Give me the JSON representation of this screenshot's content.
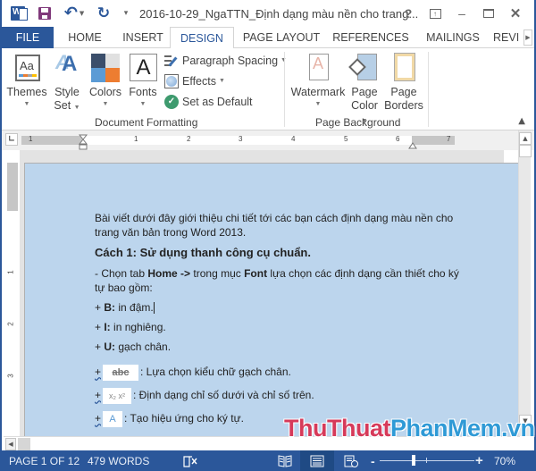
{
  "app": {
    "title": "2016-10-29_NgaTTN_Định dạng màu nền cho trang...",
    "icons": {
      "app_logo": "word-logo-icon",
      "save": "save-icon",
      "undo": "undo-icon",
      "redo": "redo-icon",
      "customize": "customize-qat-icon"
    },
    "window_controls": {
      "help": "?",
      "ribbon_display": "⊡",
      "minimize": "–",
      "maximize": "☐",
      "close": "✕"
    }
  },
  "tabs": [
    {
      "label": "FILE",
      "active": false
    },
    {
      "label": "HOME",
      "active": false
    },
    {
      "label": "INSERT",
      "active": false
    },
    {
      "label": "DESIGN",
      "active": true
    },
    {
      "label": "PAGE LAYOUT",
      "active": false
    },
    {
      "label": "REFERENCES",
      "active": false
    },
    {
      "label": "MAILINGS",
      "active": false
    },
    {
      "label": "REVI",
      "active": false
    }
  ],
  "ribbon": {
    "document_formatting": {
      "label": "Document Formatting",
      "themes": "Themes",
      "style_set_1": "Style",
      "style_set_2": "Set",
      "colors": "Colors",
      "fonts": "Fonts",
      "paragraph_spacing": "Paragraph Spacing",
      "effects": "Effects",
      "set_as_default": "Set as Default",
      "theme_colors": [
        "#3b4e6b",
        "#e0e0e0",
        "#5b9bd5",
        "#ed7d31"
      ]
    },
    "page_background": {
      "label": "Page Background",
      "watermark": "Watermark",
      "page_color_1": "Page",
      "page_color_2": "Color",
      "page_borders_1": "Page",
      "page_borders_2": "Borders"
    }
  },
  "ruler": {
    "marks": [
      "1",
      "1",
      "2",
      "3",
      "4",
      "5",
      "6",
      "7"
    ],
    "vertical_marks": [
      "1",
      "2",
      "3"
    ]
  },
  "document": {
    "page_color": "#bcd5ed",
    "intro": "Bài viết dưới đây giới thiệu chi tiết tới các bạn cách định dạng màu nền cho trang văn bản trong Word 2013.",
    "heading": "Cách 1: Sử dụng thanh công cụ chuẩn.",
    "step_prefix": "- Chọn tab ",
    "step_home": "Home ->",
    "step_mid": " trong mục ",
    "step_font": "Font",
    "step_suffix": " lựa chọn các định dạng cần thiết cho ký tự bao gồm:",
    "items": [
      {
        "prefix": "+ ",
        "key": "B:",
        "text": " in đậm."
      },
      {
        "prefix": "+ ",
        "key": "I:",
        "text": " in nghiêng."
      },
      {
        "prefix": "+ ",
        "key": "U:",
        "text": " gạch chân."
      }
    ],
    "image_items": [
      {
        "prefix": "+",
        "image_label": "abc",
        "text": ": Lựa chọn kiểu chữ gạch chân."
      },
      {
        "prefix": "+",
        "image_label": "x₂ x²",
        "text": ": Định dạng chỉ số dưới và chỉ số trên."
      },
      {
        "prefix": "+",
        "image_label": "A",
        "text": ": Tạo hiệu ứng cho ký tự."
      }
    ]
  },
  "watermark": {
    "part1": "ThuThuat",
    "part2": "PhanMem.vn"
  },
  "status": {
    "page": "PAGE 1 OF 12",
    "words": "479 WORDS",
    "proofing_icon": "proofing-error-icon",
    "zoom_minus": "-",
    "zoom_plus": "+",
    "zoom": "70%",
    "zoom_percent": 70
  }
}
